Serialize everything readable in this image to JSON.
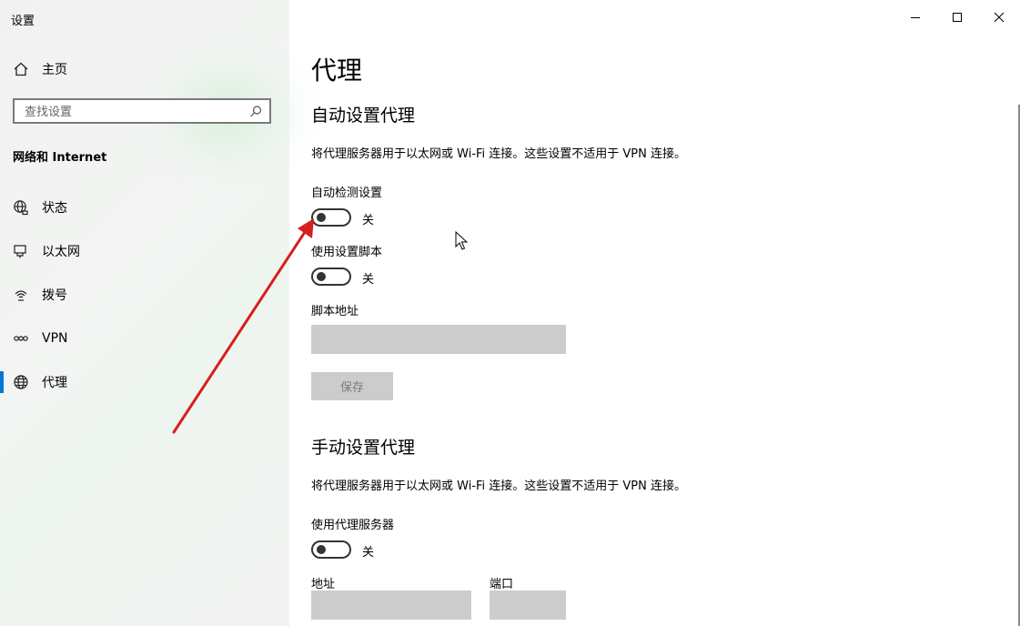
{
  "window": {
    "title": "设置"
  },
  "sidebar": {
    "home_label": "主页",
    "search_placeholder": "查找设置",
    "section_heading": "网络和 Internet",
    "items": [
      {
        "label": "状态",
        "icon": "globe-status-icon"
      },
      {
        "label": "以太网",
        "icon": "ethernet-icon"
      },
      {
        "label": "拨号",
        "icon": "dialup-icon"
      },
      {
        "label": "VPN",
        "icon": "vpn-icon"
      },
      {
        "label": "代理",
        "icon": "globe-icon",
        "selected": true
      }
    ]
  },
  "main": {
    "page_title": "代理",
    "auto": {
      "heading": "自动设置代理",
      "description": "将代理服务器用于以太网或 Wi-Fi 连接。这些设置不适用于 VPN 连接。",
      "detect_label": "自动检测设置",
      "detect_state": "关",
      "script_label": "使用设置脚本",
      "script_state": "关",
      "address_label": "脚本地址",
      "address_value": "",
      "save_label": "保存"
    },
    "manual": {
      "heading": "手动设置代理",
      "description": "将代理服务器用于以太网或 Wi-Fi 连接。这些设置不适用于 VPN 连接。",
      "use_proxy_label": "使用代理服务器",
      "use_proxy_state": "关",
      "address_label": "地址",
      "port_label": "端口",
      "address_value": "",
      "port_value": ""
    }
  },
  "colors": {
    "accent": "#0078d7",
    "annotation_arrow": "#d81e1e",
    "disabled_fill": "#cccccc"
  }
}
